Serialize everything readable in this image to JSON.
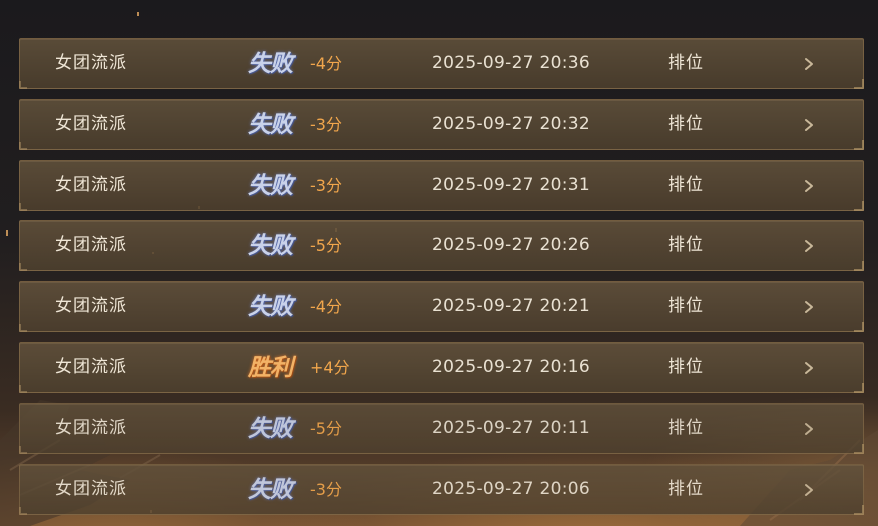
{
  "records": [
    {
      "mode": "女团流派",
      "result": "失败",
      "result_type": "lose",
      "score": "-4分",
      "time": "2025-09-27 20:36",
      "type": "排位"
    },
    {
      "mode": "女团流派",
      "result": "失败",
      "result_type": "lose",
      "score": "-3分",
      "time": "2025-09-27 20:32",
      "type": "排位"
    },
    {
      "mode": "女团流派",
      "result": "失败",
      "result_type": "lose",
      "score": "-3分",
      "time": "2025-09-27 20:31",
      "type": "排位"
    },
    {
      "mode": "女团流派",
      "result": "失败",
      "result_type": "lose",
      "score": "-5分",
      "time": "2025-09-27 20:26",
      "type": "排位"
    },
    {
      "mode": "女团流派",
      "result": "失败",
      "result_type": "lose",
      "score": "-4分",
      "time": "2025-09-27 20:21",
      "type": "排位"
    },
    {
      "mode": "女团流派",
      "result": "胜利",
      "result_type": "win",
      "score": "+4分",
      "time": "2025-09-27 20:16",
      "type": "排位"
    },
    {
      "mode": "女团流派",
      "result": "失败",
      "result_type": "lose",
      "score": "-5分",
      "time": "2025-09-27 20:11",
      "type": "排位"
    },
    {
      "mode": "女团流派",
      "result": "失败",
      "result_type": "lose",
      "score": "-3分",
      "time": "2025-09-27 20:06",
      "type": "排位"
    }
  ],
  "colors": {
    "lose": "#c9d2ea",
    "win": "#f2b266",
    "score": "#f1a64c",
    "row_border": "#96784f"
  },
  "icons": {
    "row_arrow": "chevron-right-icon"
  }
}
